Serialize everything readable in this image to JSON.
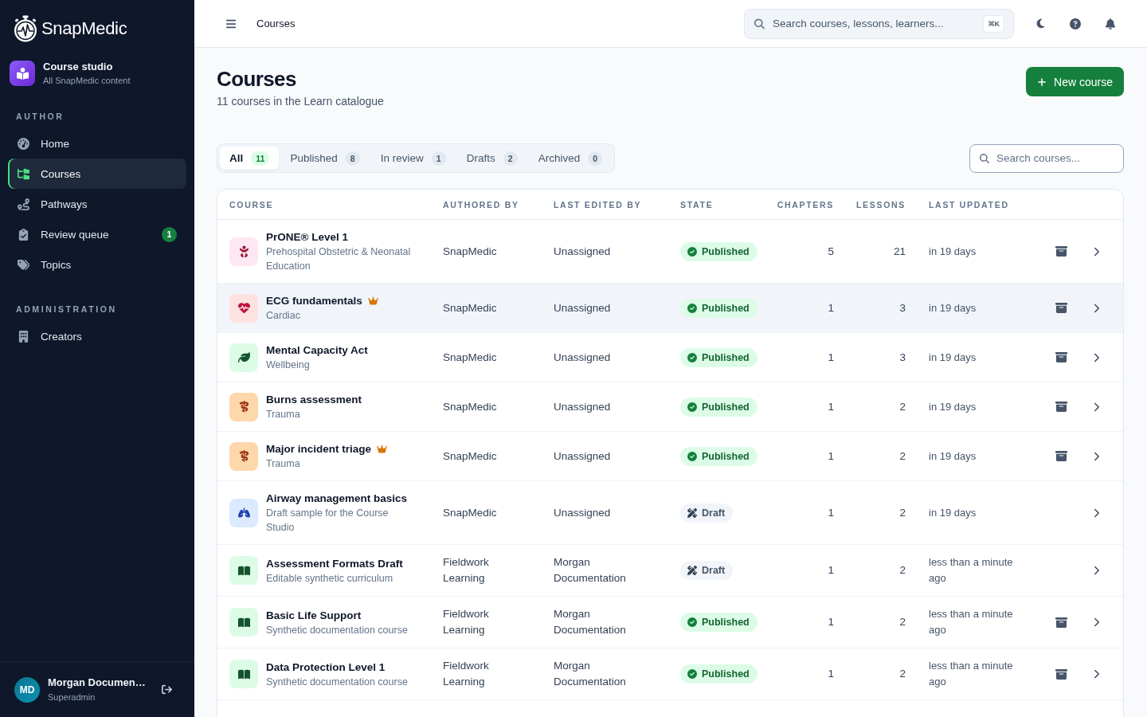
{
  "sidebar": {
    "brand": "SnapMedic",
    "workspace": {
      "title": "Course studio",
      "subtitle": "All SnapMedic content"
    },
    "sections": [
      {
        "title": "AUTHOR",
        "items": [
          {
            "label": "Home",
            "selected": false
          },
          {
            "label": "Courses",
            "selected": true
          },
          {
            "label": "Pathways",
            "selected": false
          },
          {
            "label": "Review queue",
            "selected": false,
            "badge": "1"
          },
          {
            "label": "Topics",
            "selected": false
          }
        ]
      },
      {
        "title": "ADMINISTRATION",
        "items": [
          {
            "label": "Creators",
            "selected": false
          }
        ]
      }
    ],
    "user": {
      "initials": "MD",
      "name": "Morgan Documen…",
      "role": "Superadmin"
    }
  },
  "topbar": {
    "breadcrumb": "Courses",
    "search": {
      "placeholder": "Search courses, lessons, learners...",
      "shortcut": "⌘K"
    }
  },
  "page": {
    "title": "Courses",
    "subtitle": "11 courses in the Learn catalogue",
    "primary_button": "New course"
  },
  "tabs": [
    {
      "label": "All",
      "count": "11",
      "selected": true
    },
    {
      "label": "Published",
      "count": "8",
      "selected": false
    },
    {
      "label": "In review",
      "count": "1",
      "selected": false
    },
    {
      "label": "Drafts",
      "count": "2",
      "selected": false
    },
    {
      "label": "Archived",
      "count": "0",
      "selected": false
    }
  ],
  "course_search": {
    "placeholder": "Search courses..."
  },
  "table": {
    "columns": [
      "COURSE",
      "AUTHORED BY",
      "LAST EDITED BY",
      "STATE",
      "CHAPTERS",
      "LESSONS",
      "LAST UPDATED"
    ],
    "rows": [
      {
        "kind": "obstetric",
        "title": "PrONE® Level 1",
        "subtitle": "Prehospital Obstetric & Neonatal Education",
        "premium": false,
        "authored_by": "SnapMedic",
        "last_edited_by": "Unassigned",
        "status": {
          "kind": "published",
          "label": "Published"
        },
        "chapters": "5",
        "lessons": "21",
        "last_updated": "in 19 days",
        "archivable": true,
        "hovered": false
      },
      {
        "kind": "cardiac",
        "title": "ECG fundamentals",
        "subtitle": "Cardiac",
        "premium": true,
        "authored_by": "SnapMedic",
        "last_edited_by": "Unassigned",
        "status": {
          "kind": "published",
          "label": "Published"
        },
        "chapters": "1",
        "lessons": "3",
        "last_updated": "in 19 days",
        "archivable": true,
        "hovered": true
      },
      {
        "kind": "wellbeing",
        "title": "Mental Capacity Act",
        "subtitle": "Wellbeing",
        "premium": false,
        "authored_by": "SnapMedic",
        "last_edited_by": "Unassigned",
        "status": {
          "kind": "published",
          "label": "Published"
        },
        "chapters": "1",
        "lessons": "3",
        "last_updated": "in 19 days",
        "archivable": true,
        "hovered": false
      },
      {
        "kind": "trauma",
        "title": "Burns assessment",
        "subtitle": "Trauma",
        "premium": false,
        "authored_by": "SnapMedic",
        "last_edited_by": "Unassigned",
        "status": {
          "kind": "published",
          "label": "Published"
        },
        "chapters": "1",
        "lessons": "2",
        "last_updated": "in 19 days",
        "archivable": true,
        "hovered": false
      },
      {
        "kind": "trauma",
        "title": "Major incident triage",
        "subtitle": "Trauma",
        "premium": true,
        "authored_by": "SnapMedic",
        "last_edited_by": "Unassigned",
        "status": {
          "kind": "published",
          "label": "Published"
        },
        "chapters": "1",
        "lessons": "2",
        "last_updated": "in 19 days",
        "archivable": true,
        "hovered": false
      },
      {
        "kind": "respiratory",
        "title": "Airway management basics",
        "subtitle": "Draft sample for the Course Studio",
        "premium": false,
        "authored_by": "SnapMedic",
        "last_edited_by": "Unassigned",
        "status": {
          "kind": "draft",
          "label": "Draft"
        },
        "chapters": "1",
        "lessons": "2",
        "last_updated": "in 19 days",
        "archivable": false,
        "hovered": false
      },
      {
        "kind": "book",
        "title": "Assessment Formats Draft",
        "subtitle": "Editable synthetic curriculum",
        "premium": false,
        "authored_by": "Fieldwork Learning",
        "last_edited_by": "Morgan Documentation",
        "status": {
          "kind": "draft",
          "label": "Draft"
        },
        "chapters": "1",
        "lessons": "2",
        "last_updated": "less than a minute ago",
        "archivable": false,
        "hovered": false
      },
      {
        "kind": "book",
        "title": "Basic Life Support",
        "subtitle": "Synthetic documentation course",
        "premium": false,
        "authored_by": "Fieldwork Learning",
        "last_edited_by": "Morgan Documentation",
        "status": {
          "kind": "published",
          "label": "Published"
        },
        "chapters": "1",
        "lessons": "2",
        "last_updated": "less than a minute ago",
        "archivable": true,
        "hovered": false
      },
      {
        "kind": "book",
        "title": "Data Protection Level 1",
        "subtitle": "Synthetic documentation course",
        "premium": false,
        "authored_by": "Fieldwork Learning",
        "last_edited_by": "Morgan Documentation",
        "status": {
          "kind": "published",
          "label": "Published"
        },
        "chapters": "1",
        "lessons": "2",
        "last_updated": "less than a minute ago",
        "archivable": true,
        "hovered": false
      }
    ]
  }
}
